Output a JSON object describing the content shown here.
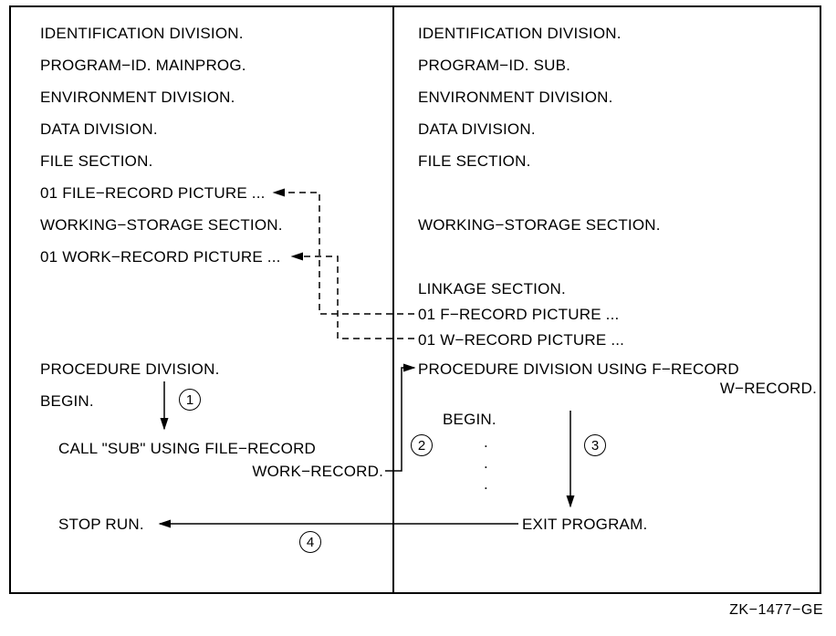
{
  "figure_id": "ZK−1477−GE",
  "left": {
    "l1": "IDENTIFICATION DIVISION.",
    "l2": "PROGRAM−ID.  MAINPROG.",
    "l3": "ENVIRONMENT DIVISION.",
    "l4": "DATA DIVISION.",
    "l5": "FILE SECTION.",
    "l6": "01 FILE−RECORD PICTURE ...",
    "l7": "WORKING−STORAGE SECTION.",
    "l8": "01 WORK−RECORD PICTURE ...",
    "l9": "PROCEDURE DIVISION.",
    "l10": "BEGIN.",
    "l11": "CALL \"SUB\" USING FILE−RECORD",
    "l12": "WORK−RECORD.",
    "l13": "STOP RUN."
  },
  "right": {
    "r1": "IDENTIFICATION DIVISION.",
    "r2": "PROGRAM−ID.  SUB.",
    "r3": "ENVIRONMENT DIVISION.",
    "r4": "DATA DIVISION.",
    "r5": "FILE SECTION.",
    "r6": "WORKING−STORAGE SECTION.",
    "r7": "LINKAGE SECTION.",
    "r8": "01 F−RECORD PICTURE ...",
    "r9": "01 W−RECORD PICTURE ...",
    "r10": "PROCEDURE DIVISION USING F−RECORD",
    "r10b": "W−RECORD.",
    "r11": "BEGIN.",
    "d1": ".",
    "d2": ".",
    "d3": ".",
    "r12": "EXIT PROGRAM."
  },
  "markers": {
    "m1": "1",
    "m2": "2",
    "m3": "3",
    "m4": "4"
  }
}
